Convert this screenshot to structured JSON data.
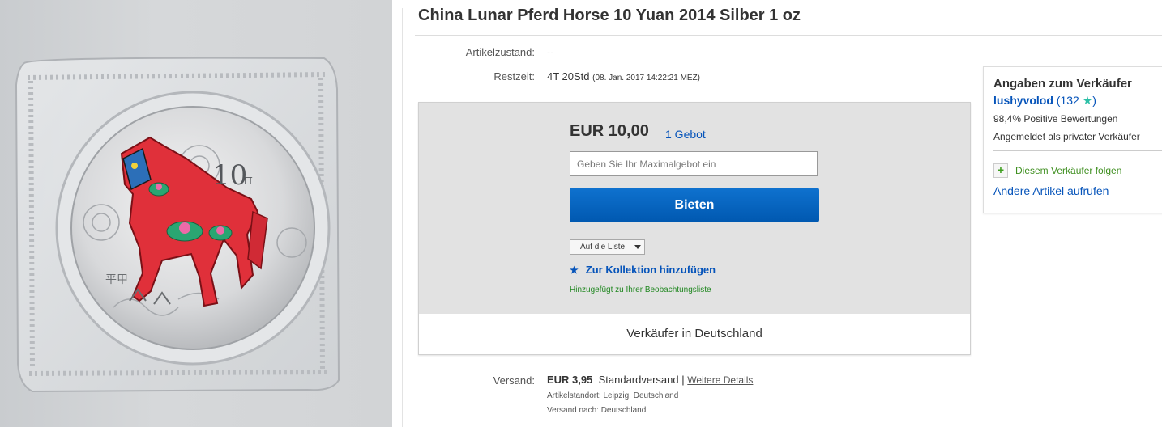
{
  "product": {
    "title": "China Lunar Pferd Horse 10 Yuan 2014 Silber 1 oz",
    "coin_denomination": "10",
    "coin_unit_glyph": "π",
    "coin_mark": "平甲"
  },
  "details": {
    "condition_label": "Artikelzustand:",
    "condition_value": "--",
    "remaining_label": "Restzeit:",
    "remaining_value": "4T 20Std",
    "remaining_end": "(08. Jan. 2017  14:22:21 MEZ)"
  },
  "bid": {
    "price": "EUR 10,00",
    "bid_count": "1 Gebot",
    "max_bid_placeholder": "Geben Sie Ihr Maximalgebot ein",
    "bid_button": "Bieten",
    "add_to_list": "Auf die Liste",
    "add_collection": "Zur Kollektion hinzufügen",
    "watchlist_note": "Hinzugefügt zu Ihrer Beobachtungsliste",
    "seller_location": "Verkäufer in Deutschland"
  },
  "shipping": {
    "label": "Versand:",
    "price": "EUR 3,95",
    "method": "Standardversand",
    "separator": "|",
    "details_link": "Weitere Details",
    "location": "Artikelstandort:  Leipzig, Deutschland",
    "ships_to": "Versand nach:  Deutschland"
  },
  "seller": {
    "heading": "Angaben zum Verkäufer",
    "name": "lushyvolod",
    "feedback_open": "(",
    "feedback_score": "132",
    "feedback_close": ")",
    "positive": "98,4% Positive Bewertungen",
    "registered": "Angemeldet als privater Verkäufer",
    "follow": "Diesem Verkäufer folgen",
    "other_items": "Andere Artikel aufrufen"
  },
  "colors": {
    "link": "#0654ba",
    "button": "#0f6fcc",
    "follow_green": "#3f8f20",
    "watch_green": "#228822",
    "star_teal": "#2bbfa6",
    "horse_red": "#e0303a"
  }
}
